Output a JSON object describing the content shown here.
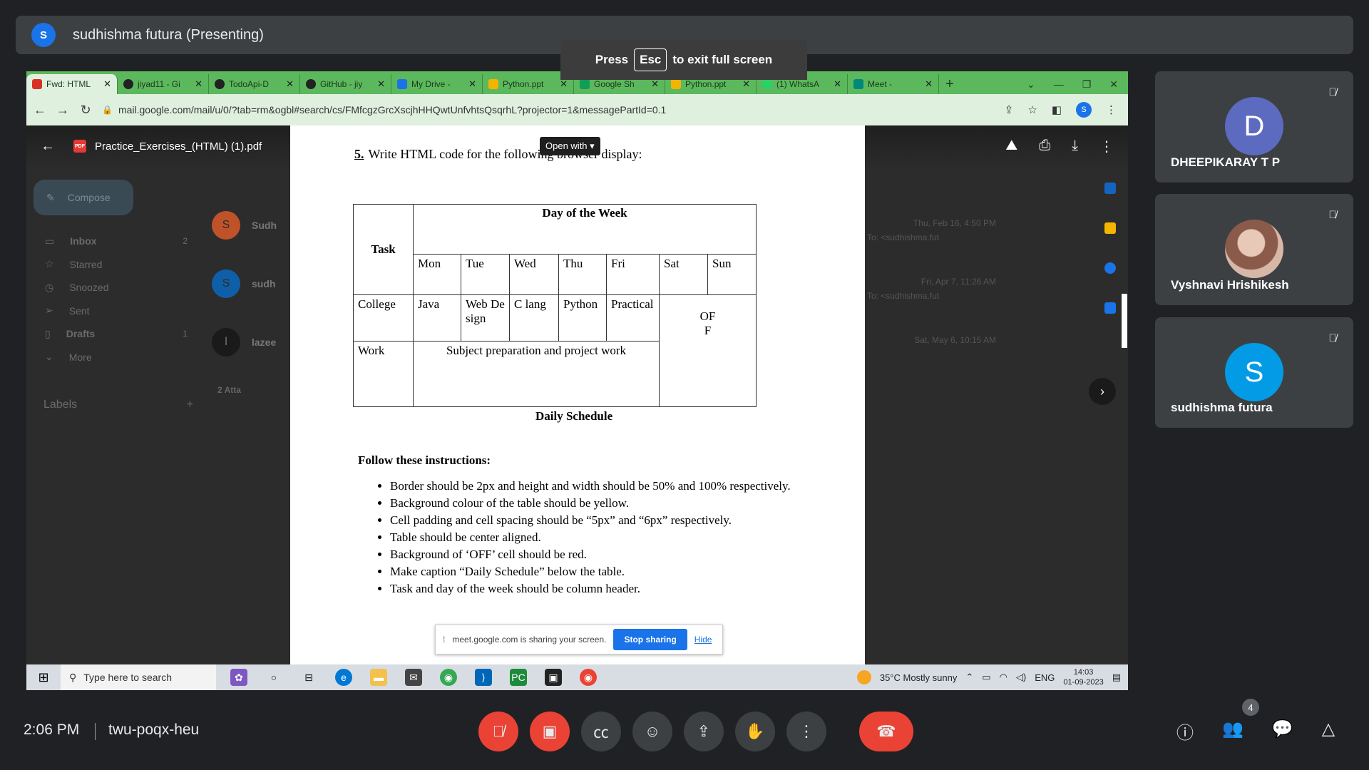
{
  "presenter": {
    "avatar_letter": "S",
    "label": "sudhishma futura (Presenting)"
  },
  "toast": {
    "press": "Press",
    "key": "Esc",
    "rest": "to exit full screen"
  },
  "browser": {
    "tabs": [
      {
        "label": "Fwd: HTML",
        "color": "#d93025"
      },
      {
        "label": "jiyad11 - Gi",
        "color": "#222"
      },
      {
        "label": "TodoApi-D",
        "color": "#222"
      },
      {
        "label": "GitHub - jiy",
        "color": "#222"
      },
      {
        "label": "My Drive -",
        "color": "#1a73e8"
      },
      {
        "label": "Python.ppt",
        "color": "#f4b400"
      },
      {
        "label": "Google Sh",
        "color": "#0f9d58"
      },
      {
        "label": "Python.ppt",
        "color": "#f4b400"
      },
      {
        "label": "(1) WhatsA",
        "color": "#25d366"
      },
      {
        "label": "Meet -",
        "color": "#00897b"
      }
    ],
    "url": "mail.google.com/mail/u/0/?tab=rm&ogbl#search/cs/FMfcgzGrcXscjhHHQwtUnfvhtsQsqrhL?projector=1&messagePartId=0.1",
    "profile_letter": "S"
  },
  "gmail": {
    "compose": "Compose",
    "nav": [
      {
        "label": "Inbox",
        "count": "2"
      },
      {
        "label": "Starred",
        "count": ""
      },
      {
        "label": "Snoozed",
        "count": ""
      },
      {
        "label": "Sent",
        "count": ""
      },
      {
        "label": "Drafts",
        "count": "1"
      },
      {
        "label": "More",
        "count": ""
      }
    ],
    "labels_title": "Labels",
    "rows": [
      {
        "avatar": "S",
        "name": "Sudh",
        "date": "Thu, Feb 16, 4:50 PM",
        "subject": "S TASK To: <sudhishma.fut"
      },
      {
        "avatar": "S",
        "name": "sudh",
        "date": "Fri, Apr 7, 11:26 AM",
        "subject": "S TASK To: <sudhishma.fut"
      },
      {
        "avatar": "l",
        "name": "lazee",
        "date": "Sat, May 6, 10:15 AM",
        "subject": ""
      }
    ],
    "attachments": "2 Atta"
  },
  "pdf": {
    "filename": "Practice_Exercises_(HTML) (1).pdf",
    "open_with": "Open with",
    "question_num": "5.",
    "question_text": "Write HTML code for the following browser display:",
    "table": {
      "task": "Task",
      "day_header": "Day of the Week",
      "days": [
        "Mon",
        "Tue",
        "Wed",
        "Thu",
        "Fri",
        "Sat",
        "Sun"
      ],
      "college": "College",
      "college_cells": [
        "Java",
        "Web Design",
        "C lang",
        "Python",
        "Practical"
      ],
      "off": "OFF",
      "work": "Work",
      "work_text": "Subject preparation and project work"
    },
    "caption": "Daily Schedule",
    "instructions_title": "Follow these instructions:",
    "instructions": [
      "Border should be 2px and height and width should be 50% and 100% respectively.",
      "Background colour of the table should be yellow.",
      "Cell padding and cell spacing should be “5px” and “6px” respectively.",
      "Table should be center aligned.",
      "Background of ‘OFF’ cell should be red.",
      "Make caption “Daily Schedule” below the table.",
      "Task and day of the week should be column header."
    ]
  },
  "sharebar": {
    "text": "meet.google.com is sharing your screen.",
    "stop": "Stop sharing",
    "hide": "Hide"
  },
  "taskbar": {
    "search_placeholder": "Type here to search",
    "weather": "35°C  Mostly sunny",
    "lang": "ENG",
    "time": "14:03",
    "date": "01-09-2023"
  },
  "participants": [
    {
      "letter": "D",
      "name": "DHEEPIKARAY T P",
      "color": "#5c6bc0"
    },
    {
      "letter": "",
      "name": "Vyshnavi Hrishikesh",
      "color": "#b08b7a"
    },
    {
      "letter": "S",
      "name": "sudhishma futura",
      "color": "#039be5"
    }
  ],
  "meeting": {
    "time": "2:06 PM",
    "code": "twu-poqx-heu",
    "people_count": "4"
  }
}
